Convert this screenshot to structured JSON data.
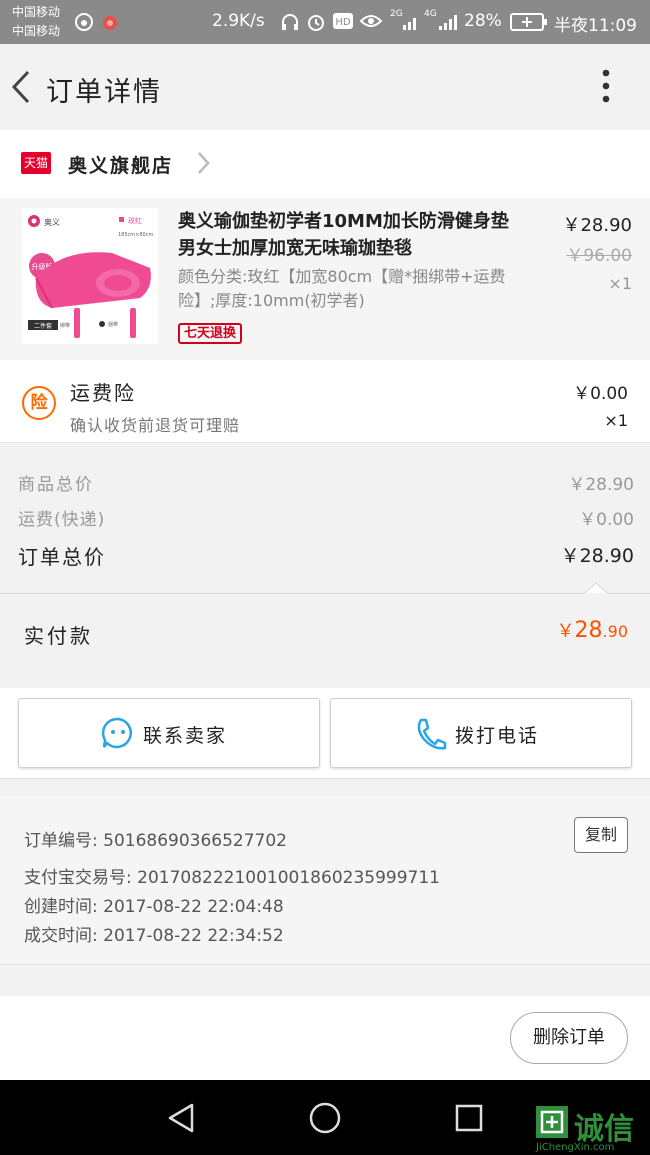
{
  "status_bar": {
    "carrier_1": "中国移动",
    "carrier_2": "中国移动",
    "speed": "2.9K/s",
    "network_1": "2G",
    "network_2": "4G",
    "battery": "28%",
    "time": "半夜11:09"
  },
  "app_bar": {
    "title": "订单详情"
  },
  "shop": {
    "badge": "天猫",
    "name": "奥义旗舰店"
  },
  "product": {
    "name": "奥义瑜伽垫初学者10MM加长防滑健身垫男女士加厚加宽无味瑜珈垫毯",
    "spec": "颜色分类:玫红【加宽80cm【赠*捆绑带+运费险】;厚度:10mm(初学者)",
    "tag": "七天退换",
    "price": "￥28.90",
    "original_price": "￥96.00",
    "qty": "×1",
    "thumb": {
      "brand": "奥义",
      "color": "玫红",
      "size": "185cm×80cm",
      "upgrade": "升级版",
      "set": "二件套",
      "strap_1": "绑带",
      "strap_2": "捆带"
    }
  },
  "insurance": {
    "icon": "险",
    "title": "运费险",
    "desc": "确认收货前退货可理赔",
    "price": "￥0.00",
    "qty": "×1"
  },
  "totals": {
    "goods_label": "商品总价",
    "goods_value": "￥28.90",
    "shipping_label": "运费(快递)",
    "shipping_value": "￥0.00",
    "order_label": "订单总价",
    "order_value": "￥28.90"
  },
  "paid": {
    "label": "实付款",
    "currency": "￥",
    "int": "28",
    "dec": ".90"
  },
  "actions": {
    "contact_label": "联系卖家",
    "call_label": "拨打电话"
  },
  "order_info": {
    "order_no": "订单编号: 501686903665277​02",
    "alipay_no": "支付宝交易号: 2017082221001001860235999711",
    "created": "创建时间: 2017-08-22 22:04:48",
    "closed": "成交时间: 2017-08-22 22:34:52",
    "copy_label": "复制"
  },
  "footer": {
    "delete_label": "删除订单"
  },
  "watermark": {
    "brand": "诚信",
    "url": "JiChengXin.com"
  },
  "colors": {
    "accent": "#ff5000",
    "tmall": "#e4002b",
    "contact_blue": "#2aa5e6",
    "tag_red": "#d0021b"
  }
}
